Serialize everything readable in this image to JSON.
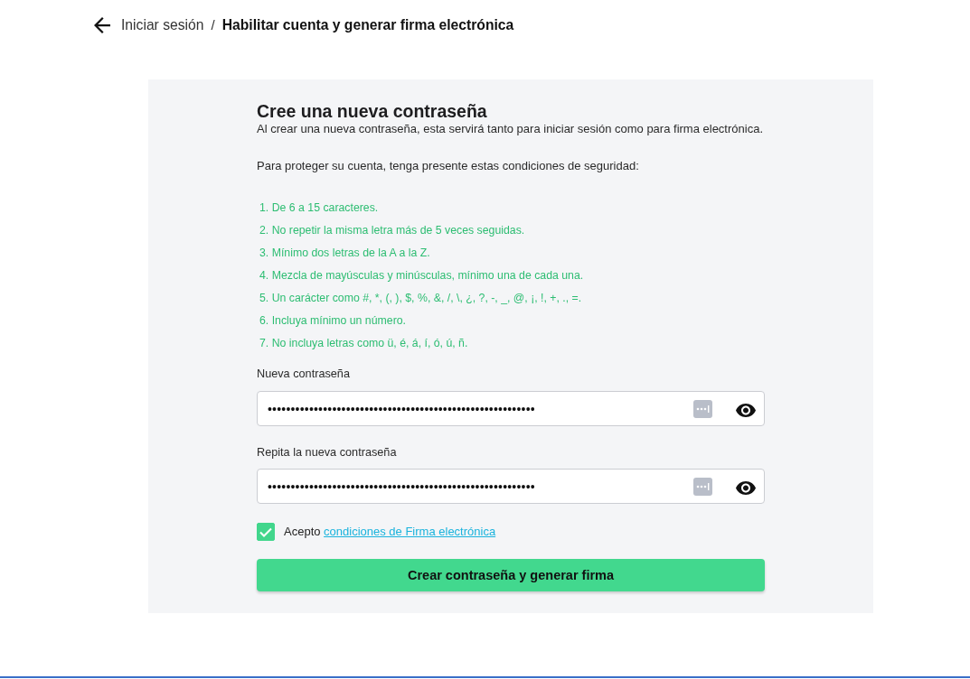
{
  "breadcrumb": {
    "separator": "/",
    "items": [
      {
        "label": "Iniciar sesión",
        "current": false
      },
      {
        "label": "Habilitar cuenta y generar firma electrónica",
        "current": true
      }
    ]
  },
  "form": {
    "title": "Cree una nueva contraseña",
    "subtitle": "Al crear una nueva contraseña, esta servirá tanto para iniciar sesión como para firma electrónica.",
    "intro": "Para proteger su cuenta, tenga presente estas condiciones de seguridad:",
    "conditions": [
      "1. De 6 a 15 caracteres.",
      "2. No repetir la misma letra más de 5 veces seguidas.",
      "3. Mínimo dos letras de la A a la Z.",
      "4. Mezcla de mayúsculas y minúsculas, mínimo una de cada una.",
      "5. Un carácter como #, *, (, ), $, %, &, /, \\, ¿, ?, -, _, @, ¡, !, +, ., =.",
      "6. Incluya mínimo un número.",
      "7. No incluya letras como ü, é, á, í, ó, ú, ñ."
    ],
    "fields": [
      {
        "label": "Nueva contraseña",
        "value": "••••••••••••••••••••••••••••••••••••••••••••••••••••••••••"
      },
      {
        "label": "Repita la nueva contraseña",
        "value": "••••••••••••••••••••••••••••••••••••••••••••••••••••••••••"
      }
    ],
    "terms": {
      "checked": true,
      "text": "Acepto",
      "link": "condiciones de Firma electrónica"
    },
    "submit": "Crear contraseña y generar firma"
  }
}
